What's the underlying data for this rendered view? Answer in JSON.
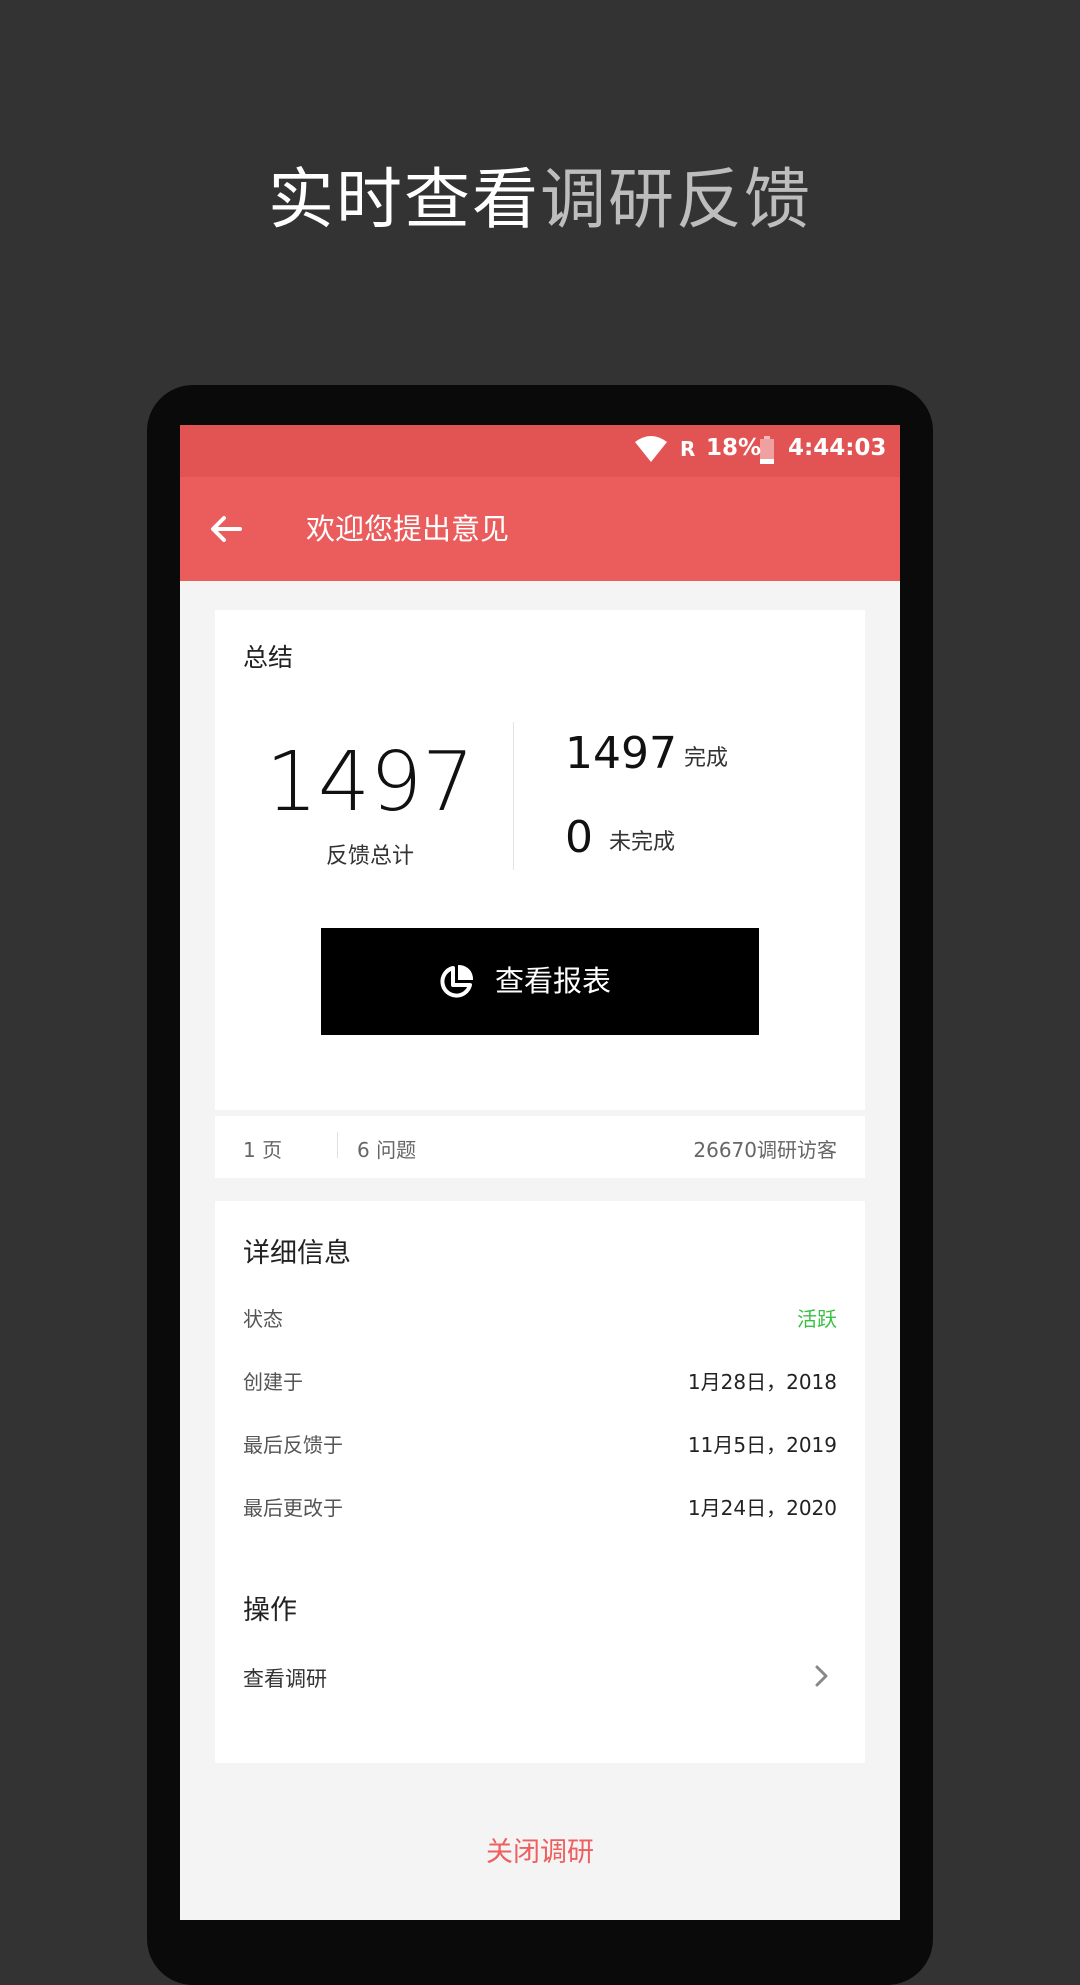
{
  "headline": {
    "part1": "实时查看",
    "part2": "调研反馈"
  },
  "statusbar": {
    "network": "R",
    "battery": "18%",
    "time": "4:44:03"
  },
  "appbar": {
    "back_icon": "arrow-left-icon",
    "title": "欢迎您提出意见"
  },
  "summary": {
    "title": "总结",
    "total": "1497",
    "total_label": "反馈总计",
    "completed": "1497",
    "completed_label": "完成",
    "incomplete": "0",
    "incomplete_label": "未完成",
    "report_button": "查看报表",
    "report_icon": "pie-chart-icon"
  },
  "stats": {
    "pages": "1 页",
    "questions": "6 问题",
    "visitors": "26670调研访客"
  },
  "details": {
    "title": "详细信息",
    "rows": [
      {
        "label": "状态",
        "value": "活跃"
      },
      {
        "label": "创建于",
        "value": "1月28日，2018"
      },
      {
        "label": "最后反馈于",
        "value": "11月5日，2019"
      },
      {
        "label": "最后更改于",
        "value": "1月24日，2020"
      }
    ]
  },
  "actions": {
    "title": "操作",
    "view_survey": "查看调研"
  },
  "close_survey": "关闭调研",
  "colors": {
    "accent": "#eb5c5c",
    "active": "#39c143",
    "status_bar": "#e25454"
  }
}
